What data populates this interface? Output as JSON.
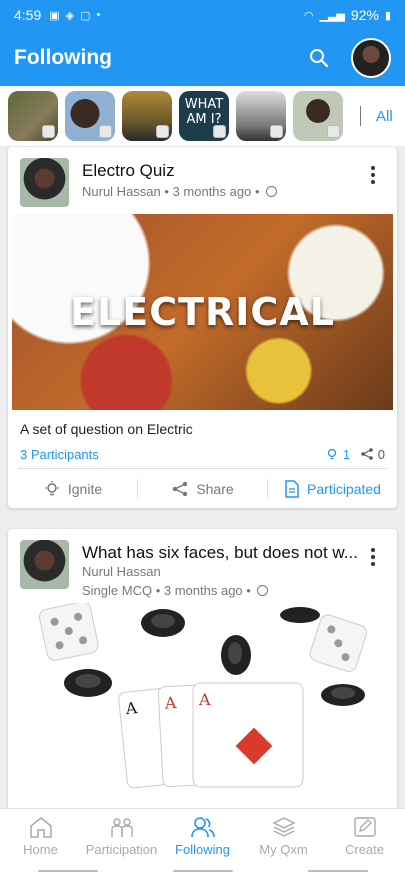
{
  "status_bar": {
    "time": "4:59",
    "battery": "92%"
  },
  "app_bar": {
    "title": "Following"
  },
  "stories": {
    "all_label": "All",
    "story4_text": "WHAT AM I?"
  },
  "posts": [
    {
      "title": "Electro Quiz",
      "author": "Nurul Hassan",
      "time": "3 months ago",
      "image_text": "ELECTRICAL",
      "description": "A set of question on Electric",
      "participants": "3 Participants",
      "ignite_count": "1",
      "share_count": "0",
      "actions": {
        "ignite": "Ignite",
        "share": "Share",
        "participated": "Participated"
      }
    },
    {
      "title": "What has six faces, but does not w...",
      "author": "Nurul Hassan",
      "type": "Single MCQ",
      "time": "3 months ago"
    }
  ],
  "bottom_nav": [
    {
      "label": "Home"
    },
    {
      "label": "Participation"
    },
    {
      "label": "Following"
    },
    {
      "label": "My Qxm"
    },
    {
      "label": "Create"
    }
  ],
  "colors": {
    "primary": "#2196f3",
    "status_red": "#c0392b"
  }
}
